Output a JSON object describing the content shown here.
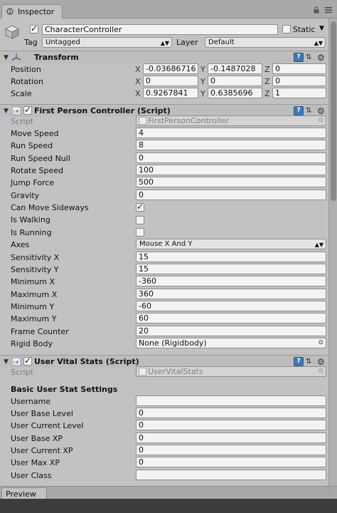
{
  "window": {
    "tab_title": "Inspector",
    "preview_label": "Preview"
  },
  "gameobject": {
    "name": "CharacterController",
    "active": true,
    "static_label": "Static",
    "static_checked": false,
    "tag_label": "Tag",
    "tag_value": "Untagged",
    "layer_label": "Layer",
    "layer_value": "Default"
  },
  "transform": {
    "title": "Transform",
    "rows": [
      {
        "label": "Position",
        "x": "-0.03686716",
        "y": "-0.1487028",
        "z": "0"
      },
      {
        "label": "Rotation",
        "x": "0",
        "y": "0",
        "z": "0"
      },
      {
        "label": "Scale",
        "x": "0.9267841",
        "y": "0.6385696",
        "z": "1"
      }
    ],
    "axis_labels": [
      "X",
      "Y",
      "Z"
    ]
  },
  "fpc": {
    "title": "First Person Controller (Script)",
    "enabled": true,
    "script_label": "Script",
    "script_value": "FirstPersonController",
    "fields": {
      "move_speed": {
        "label": "Move Speed",
        "value": "4"
      },
      "run_speed": {
        "label": "Run Speed",
        "value": "8"
      },
      "run_speed_null": {
        "label": "Run Speed Null",
        "value": "0"
      },
      "rotate_speed": {
        "label": "Rotate Speed",
        "value": "100"
      },
      "jump_force": {
        "label": "Jump Force",
        "value": "500"
      },
      "gravity": {
        "label": "Gravity",
        "value": "0"
      },
      "can_move_sideways": {
        "label": "Can Move Sideways",
        "checked": true
      },
      "is_walking": {
        "label": "Is Walking",
        "checked": false
      },
      "is_running": {
        "label": "Is Running",
        "checked": false
      },
      "axes": {
        "label": "Axes",
        "value": "Mouse X And Y"
      },
      "sensitivity_x": {
        "label": "Sensitivity X",
        "value": "15"
      },
      "sensitivity_y": {
        "label": "Sensitivity Y",
        "value": "15"
      },
      "minimum_x": {
        "label": "Minimum X",
        "value": "-360"
      },
      "maximum_x": {
        "label": "Maximum X",
        "value": "360"
      },
      "minimum_y": {
        "label": "Minimum Y",
        "value": "-60"
      },
      "maximum_y": {
        "label": "Maximum Y",
        "value": "60"
      },
      "frame_counter": {
        "label": "Frame Counter",
        "value": "20"
      },
      "rigid_body": {
        "label": "Rigid Body",
        "value": "None (Rigidbody)"
      }
    }
  },
  "uvs": {
    "title": "User Vital Stats (Script)",
    "enabled": true,
    "script_label": "Script",
    "script_value": "UserVitalStats",
    "section_header": "Basic User Stat Settings",
    "fields": {
      "username": {
        "label": "Username",
        "value": ""
      },
      "user_base_level": {
        "label": "User Base Level",
        "value": "0"
      },
      "user_current_level": {
        "label": "User Current Level",
        "value": "0"
      },
      "user_base_xp": {
        "label": "User Base XP",
        "value": "0"
      },
      "user_current_xp": {
        "label": "User Current XP",
        "value": "0"
      },
      "user_max_xp": {
        "label": "User Max XP",
        "value": "0"
      },
      "user_class": {
        "label": "User Class",
        "value": ""
      }
    }
  },
  "icons": {
    "tab": "inspector-icon",
    "lock": "lock-icon",
    "menu": "menu-icon",
    "gameobject": "cube-icon",
    "transform": "transform-axes-icon",
    "script": "cs-script-icon",
    "help": "help-book-icon",
    "settings": "gear-icon",
    "object_picker": "object-picker-icon"
  },
  "colors": {
    "panel": "#c2c2c2",
    "field": "#f3f3f3",
    "help_icon": "#3f78b8",
    "header": "#bdbdbd"
  }
}
